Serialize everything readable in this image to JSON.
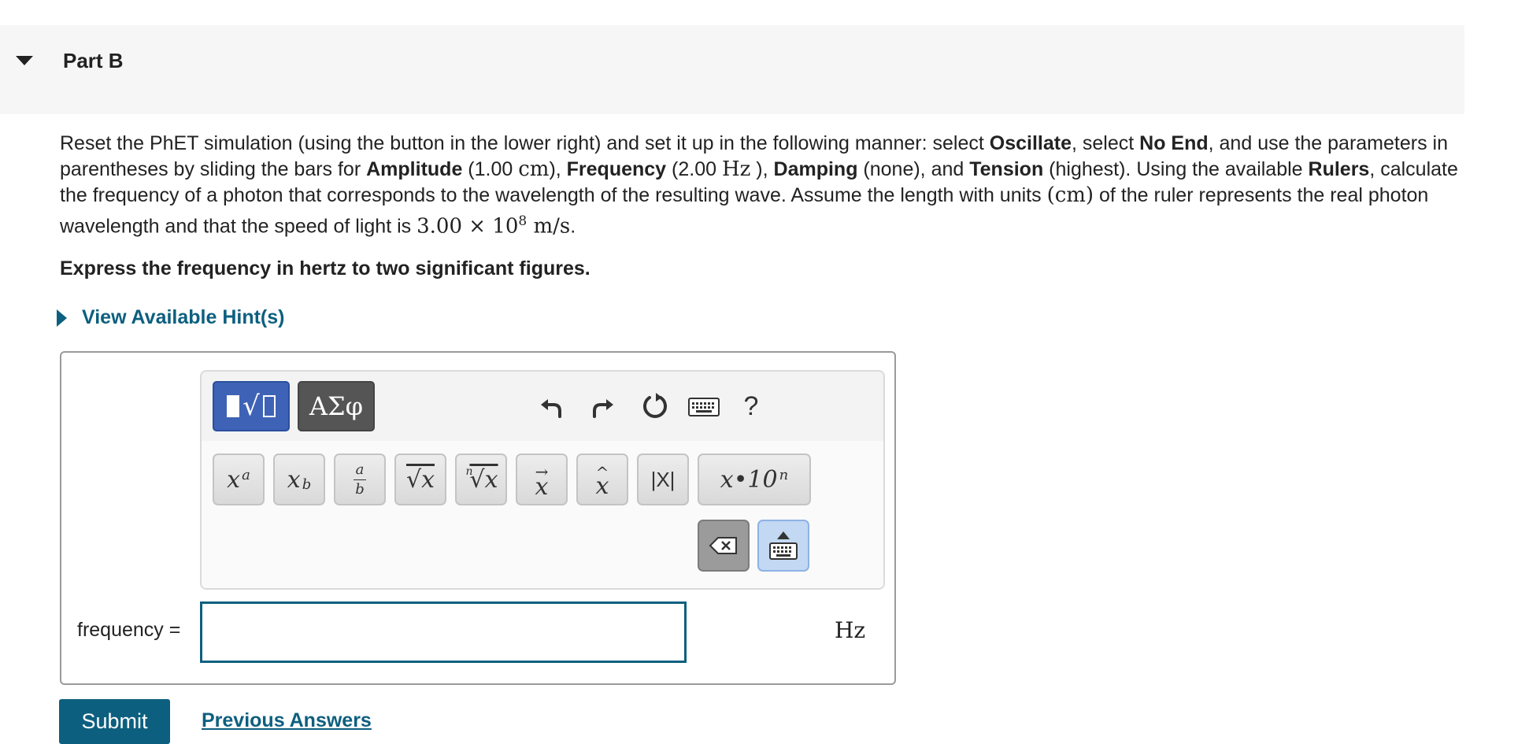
{
  "part": {
    "title": "Part B"
  },
  "question": {
    "t1": "Reset the PhET simulation (using the button in the lower right) and set it up in the following manner: select ",
    "b1": "Oscillate",
    "t2": ", select ",
    "b2": "No End",
    "t3": ", and use the parameters in parentheses by sliding the bars for ",
    "b3": "Amplitude",
    "t4": " (1.00 ",
    "m1": "cm",
    "t5": "), ",
    "b4": "Frequency",
    "t6": " (2.00 ",
    "m2": "Hz",
    "t7": " ), ",
    "b5": "Damping",
    "t8": " (none), and ",
    "b6": "Tension",
    "t9": " (highest). Using the available ",
    "b7": "Rulers",
    "t10": ", calculate the frequency of a photon that corresponds to the wavelength of the resulting wave. Assume the length with units ",
    "m3": "(cm)",
    "t11": " of the ruler represents the real photon wavelength and that the speed of light is ",
    "m4": "3.00 × 10",
    "m4_exp": "8",
    "m5": " m/s",
    "t12": "."
  },
  "instruction": "Express the frequency in hertz to two significant figures.",
  "hints": {
    "label": "View Available Hint(s)"
  },
  "editor": {
    "greek_tab_label": "ΑΣφ",
    "help_label": "?",
    "keys": {
      "power_base": "x",
      "power_exp": "a",
      "sub_base": "x",
      "sub_idx": "b",
      "frac_num": "a",
      "frac_den": "b",
      "sqrt": "√x",
      "nthroot_n": "n",
      "nthroot": "√x",
      "vector_arrow": "→",
      "vector_base": "x",
      "hat_mark": "^",
      "hat_base": "x",
      "abs": "|X|",
      "sci": "x•10",
      "sci_exp": "n"
    }
  },
  "answer": {
    "label": "frequency =",
    "value": "",
    "unit": "Hz"
  },
  "buttons": {
    "submit": "Submit",
    "previous_answers": "Previous Answers"
  },
  "colors": {
    "accent": "#0d5f7f",
    "template_tab": "#3e63b6",
    "greek_tab": "#555555"
  }
}
